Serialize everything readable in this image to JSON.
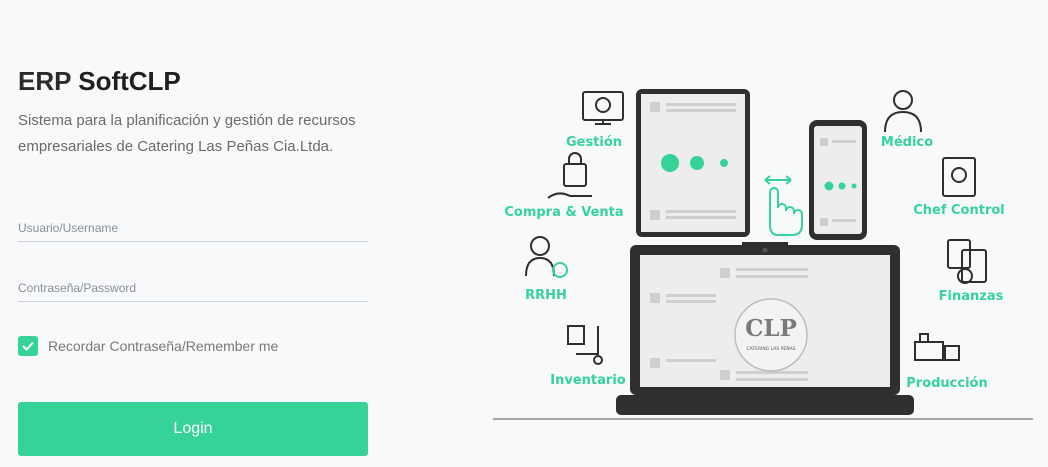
{
  "app": {
    "title_prefix": "ERP",
    "title_brand": "SoftCLP",
    "description": "Sistema para la planificación y gestión de recursos empresariales de Catering Las Peñas Cia.Ltda."
  },
  "form": {
    "username_placeholder": "Usuario/Username",
    "password_placeholder": "Contraseña/Password",
    "remember_label": "Recordar Contraseña/Remember me",
    "remember_checked": true,
    "login_label": "Login"
  },
  "illustration": {
    "modules_left": [
      "Gestión",
      "Compra & Venta",
      "RRHH",
      "Inventario"
    ],
    "modules_right": [
      "Médico",
      "Chef Control",
      "Finanzas",
      "Producción"
    ],
    "logo_text": "CLP",
    "logo_caption": "CATERING LAS PEÑAS"
  },
  "colors": {
    "accent": "#36d399",
    "dark": "#2f2f2f",
    "page_bg": "#f8f9fb"
  }
}
